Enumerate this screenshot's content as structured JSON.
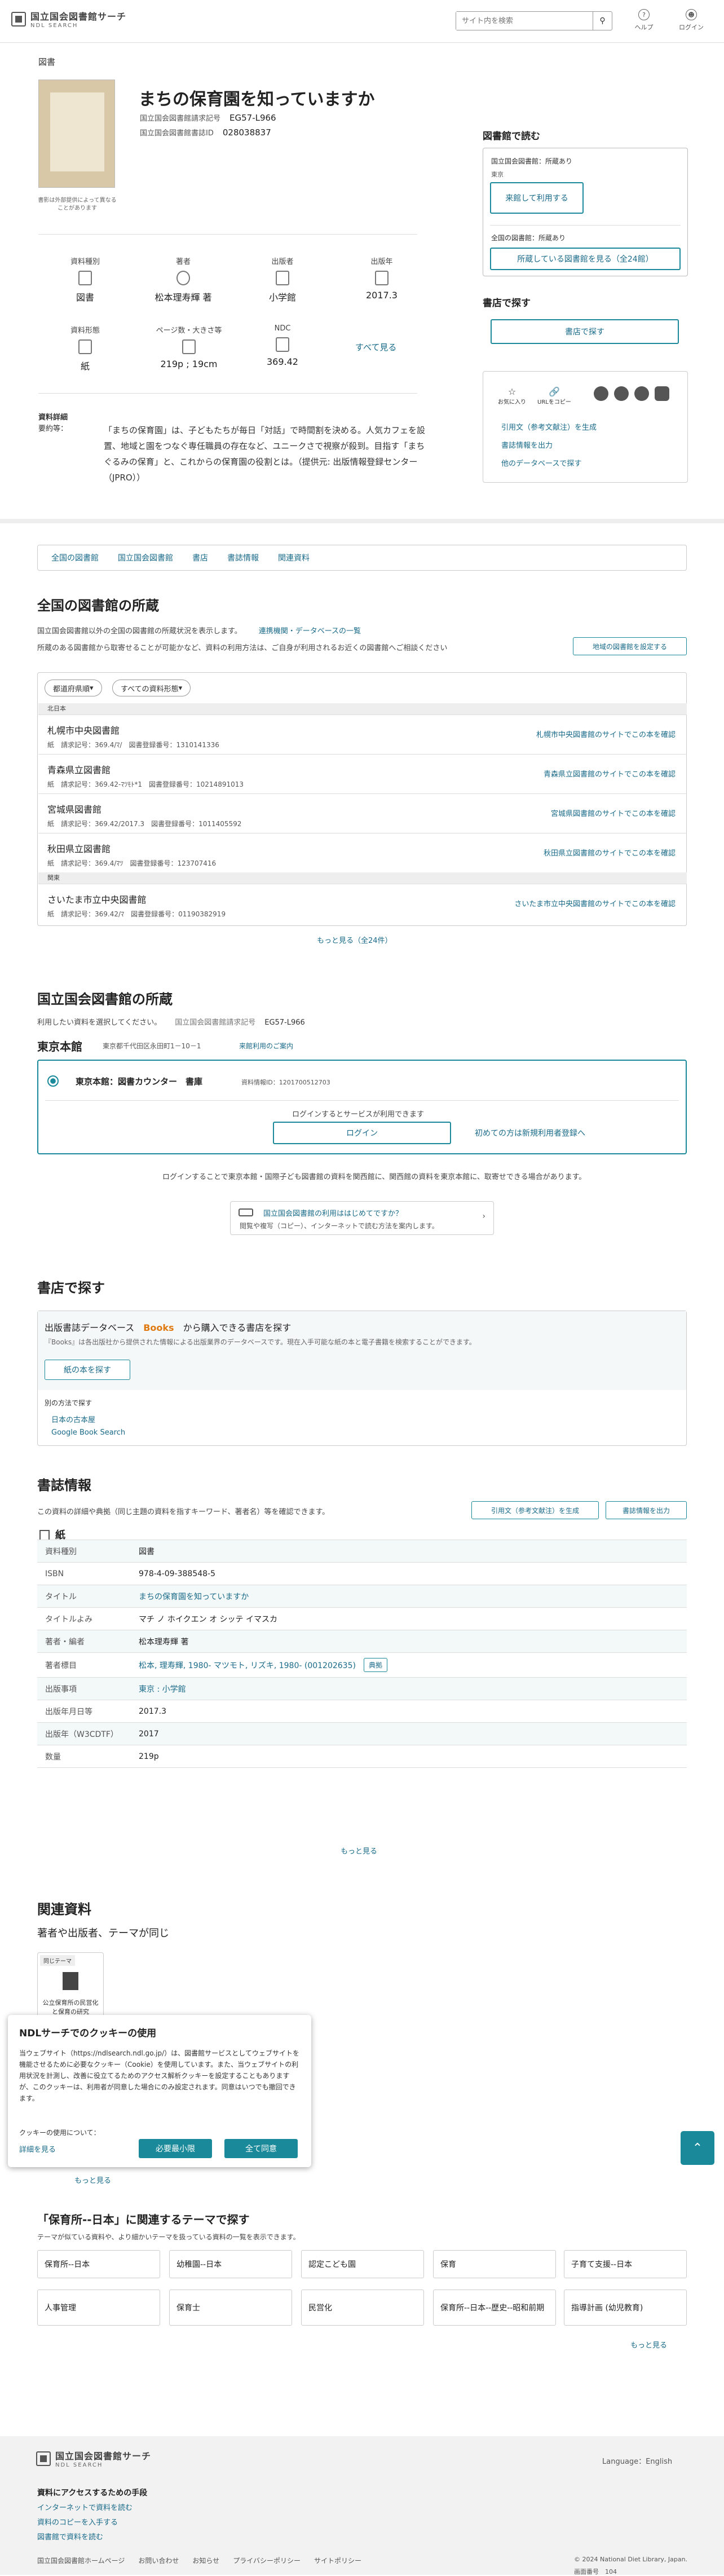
{
  "header": {
    "logo_jp": "国立国会図書館サーチ",
    "logo_en": "NDL SEARCH",
    "search_placeholder": "サイト内を検索",
    "help": "ヘルプ",
    "login": "ログイン"
  },
  "item": {
    "breadcrumb": "図書",
    "cover_note": "書影は外部提供によって異なることがあります",
    "title": "まちの保育園を知っていますか",
    "call_label": "国立国会図書館請求記号",
    "call_no": "EG57-L966",
    "bib_label": "国立国会図書館書誌ID",
    "bib_id": "028038837",
    "attrs": [
      {
        "k": "資料種別",
        "v": "図書"
      },
      {
        "k": "著者",
        "v": "松本理寿輝 著"
      },
      {
        "k": "出版者",
        "v": "小学館"
      },
      {
        "k": "出版年",
        "v": "2017.3"
      },
      {
        "k": "資料形態",
        "v": "紙"
      },
      {
        "k": "ページ数・大きさ等",
        "v": "219p ; 19cm"
      },
      {
        "k": "NDC",
        "v": "369.42"
      }
    ],
    "show_all": "すべて見る",
    "detail_label": "資料詳細",
    "summary_label": "要約等：",
    "summary": "「まちの保育園」は、子どもたちが毎日「対話」で時間割を決める。人気カフェを設置、地域と園をつなぐ専任職員の存在など、ユニークさで視察が殺到。目指す「まちぐるみの保育」と、これからの保育園の役割とは。（提供元: 出版情報登録センター（JPRO））"
  },
  "right": {
    "read_title": "図書館で読む",
    "ndl_own": "国立国会図書館：所蔵あり",
    "tokyo": "東京",
    "use_btn": "来館して利用する",
    "nat_own": "全国の図書館：所蔵あり",
    "nat_btn": "所蔵している図書館を見る（全24館）",
    "shop_title": "書店で探す",
    "shop_btn": "書店で探す",
    "fav": "お気に入り",
    "copy": "URLをコピー",
    "cite": "引用文（参考文献注）を生成",
    "output": "書誌情報を出力",
    "other_db": "他のデータベースで探す"
  },
  "tabs": [
    "全国の図書館",
    "国立国会図書館",
    "書店",
    "書誌情報",
    "関連資料"
  ],
  "national": {
    "h": "全国の図書館の所蔵",
    "p1": "国立国会図書館以外の全国の図書館の所蔵状況を表示します。",
    "p1_link": "連携機関・データベースの一覧",
    "p2": "所蔵のある図書館から取寄せることが可能かなど、資料の利用方法は、ご自身が利用されるお近くの図書館へご相談ください",
    "region_btn": "地域の図書館を設定する",
    "filter1": "都道府県順",
    "filter2": "すべての資料形態",
    "regions": [
      "北日本",
      "関東"
    ],
    "libs": [
      {
        "name": "札幌市中央図書館",
        "form": "紙",
        "call": "請求記号：369.4/ﾏ/",
        "reg": "図書登録番号：1310141336",
        "link": "札幌市中央図書館のサイトでこの本を確認"
      },
      {
        "name": "青森県立図書館",
        "form": "紙",
        "call": "請求記号：369.42-ﾏﾂﾓﾄ*1",
        "reg": "図書登録番号：10214891013",
        "link": "青森県立図書館のサイトでこの本を確認"
      },
      {
        "name": "宮城県図書館",
        "form": "紙",
        "call": "請求記号：369.42/2017.3",
        "reg": "図書登録番号：1011405592",
        "link": "宮城県図書館のサイトでこの本を確認"
      },
      {
        "name": "秋田県立図書館",
        "form": "紙",
        "call": "請求記号：369.4/ﾏﾂ",
        "reg": "図書登録番号：123707416",
        "link": "秋田県立図書館のサイトでこの本を確認"
      },
      {
        "name": "さいたま市立中央図書館",
        "form": "紙",
        "call": "請求記号：369.42/ﾏ",
        "reg": "図書登録番号：01190382919",
        "link": "さいたま市立中央図書館のサイトでこの本を確認"
      }
    ],
    "more": "もっと見る（全24件）"
  },
  "ndl": {
    "h": "国立国会図書館の所蔵",
    "instruction": "利用したい資料を選択してください。",
    "call_label": "国立国会図書館請求記号",
    "call_no": "EG57-L966",
    "branch": "東京本館",
    "addr": "東京都千代田区永田町1－10－1",
    "visit": "来館利用のご案内",
    "option": "東京本館：図書カウンター　書庫",
    "option_id": "資料情報ID：1201700512703",
    "login_note": "ログインするとサービスが利用できます",
    "login_btn": "ログイン",
    "register": "初めての方は新規利用者登録へ",
    "note": "ログインすることで東京本館・国際子ども図書館の資料を関西館に、関西館の資料を東京本館に、取寄せできる場合があります。",
    "guide_t": "国立国会図書館の利用ははじめてですか？",
    "guide_s": "閲覧や複写（コピー）、インターネットで読む方法を案内します。"
  },
  "shop": {
    "h": "書店で探す",
    "line": "出版書誌データベース",
    "books": "Books",
    "line2": "から購入できる書店を探す",
    "note": "『Books』は各出版社から提供された情報による出版業界のデータベースです。現在入手可能な紙の本と電子書籍を検索することができます。",
    "btn": "紙の本を探す",
    "other": "別の方法で探す",
    "l1": "日本の古本屋",
    "l2": "Google Book Search"
  },
  "bib": {
    "h": "書誌情報",
    "p": "この資料の詳細や典拠（同じ主題の資料を指すキーワード、著者名）等を確認できます。",
    "cite": "引用文（参考文献注）を生成",
    "out": "書誌情報を出力",
    "format": "紙",
    "rows": [
      {
        "k": "資料種別",
        "v": "図書"
      },
      {
        "k": "ISBN",
        "v": "978-4-09-388548-5"
      },
      {
        "k": "タイトル",
        "v": "まちの保育園を知っていますか"
      },
      {
        "k": "タイトルよみ",
        "v": "マチ ノ ホイクエン オ シッテ イマスカ"
      },
      {
        "k": "著者・編者",
        "v": "松本理寿輝 著"
      },
      {
        "k": "著者標目",
        "v": "松本, 理寿輝, 1980- マツモト, リズキ, 1980- (001202635)"
      },
      {
        "k": "出版事項",
        "v": "東京 : 小学館"
      },
      {
        "k": "出版年月日等",
        "v": "2017.3"
      },
      {
        "k": "出版年（W3CDTF）",
        "v": "2017"
      },
      {
        "k": "数量",
        "v": "219p"
      }
    ],
    "authority": "典拠",
    "more": "もっと見る"
  },
  "related": {
    "h": "関連資料",
    "sub": "著者や出版者、テーマが同じ",
    "tag": "同じテーマ",
    "book": "公立保育所の民営化と保育の研究",
    "more": "もっと見る"
  },
  "theme": {
    "h": "「保育所--日本」に関連するテーマで探す",
    "p": "テーマが似ている資料や、より細かいテーマを扱っている資料の一覧を表示できます。",
    "tags": [
      "保育所--日本",
      "幼稚園--日本",
      "認定こども園",
      "保育",
      "子育て支援--日本",
      "人事管理",
      "保育士",
      "民営化",
      "保育所--日本--歴史--昭和前期",
      "指導計画 (幼児教育)"
    ],
    "more": "もっと見る"
  },
  "cookie": {
    "h": "NDLサーチでのクッキーの使用",
    "body": "当ウェブサイト（https://ndlsearch.ndl.go.jp/）は、図書館サービスとしてウェブサイトを機能させるために必要なクッキー（Cookie）を使用しています。また、当ウェブサイトの利用状況を計測し、改善に役立てるためのアクセス解析クッキーを設定することもありますが、このクッキーは、利用者が同意した場合にのみ設定されます。同意はいつでも撤回できます。",
    "q": "クッキーの使用について：",
    "detail": "詳細を見る",
    "necessary": "必要最小限",
    "all": "全て同意"
  },
  "footer": {
    "logo_jp": "国立国会図書館サーチ",
    "logo_en": "NDL SEARCH",
    "lang": "Language：English",
    "h": "資料にアクセスするための手段",
    "links": [
      "インターネットで資料を読む",
      "資料のコピーを入手する",
      "図書館で資料を読む"
    ],
    "bottom": [
      "国立国会図書館ホームページ",
      "お問い合わせ",
      "お知らせ",
      "プライバシーポリシー",
      "サイトポリシー"
    ],
    "copy": "© 2024 National Diet Library, Japan.",
    "ver_label": "画面番号",
    "ver": "104"
  }
}
